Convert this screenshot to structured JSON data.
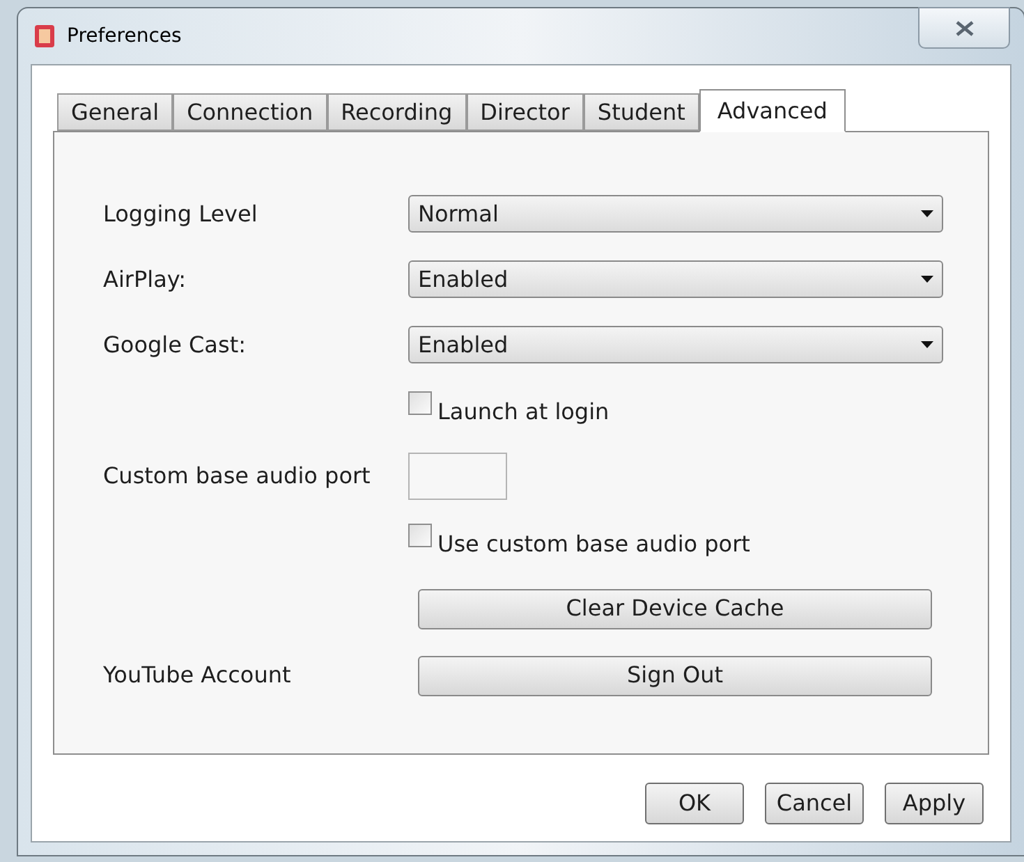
{
  "window": {
    "title": "Preferences"
  },
  "tabs": [
    {
      "label": "General",
      "selected": false
    },
    {
      "label": "Connection",
      "selected": false
    },
    {
      "label": "Recording",
      "selected": false
    },
    {
      "label": "Director",
      "selected": false
    },
    {
      "label": "Student",
      "selected": false
    },
    {
      "label": "Advanced",
      "selected": true
    }
  ],
  "rows": [
    {
      "kind": "select",
      "label": "Logging Level",
      "value": "Normal"
    },
    {
      "kind": "select",
      "label": "AirPlay:",
      "value": "Enabled"
    },
    {
      "kind": "select",
      "label": "Google Cast:",
      "value": "Enabled"
    },
    {
      "kind": "checkbox",
      "text": "Launch at login",
      "checked": false
    },
    {
      "kind": "field",
      "label": "Custom base audio port"
    },
    {
      "kind": "checkbox",
      "text": "Use custom base audio port",
      "checked": false
    },
    {
      "kind": "button",
      "text": "Clear Device Cache"
    },
    {
      "kind": "button",
      "label": "YouTube Account",
      "text": "Sign Out"
    }
  ],
  "buttons": [
    "OK",
    "Cancel",
    "Apply"
  ]
}
